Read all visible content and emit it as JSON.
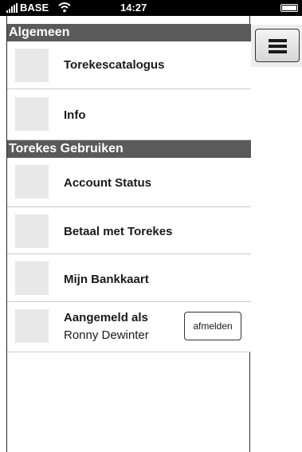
{
  "status_bar": {
    "carrier": "BASE",
    "time": "14:27",
    "icons": [
      "signal-icon",
      "wifi-icon",
      "battery-icon"
    ]
  },
  "sections": [
    {
      "header": "Algemeen",
      "items": [
        {
          "label": "Torekescatalogus"
        },
        {
          "label": "Info"
        }
      ]
    },
    {
      "header": "Torekes Gebruiken",
      "items": [
        {
          "label": "Account Status"
        },
        {
          "label": "Betaal met Torekes"
        },
        {
          "label": "Mijn Bankkaart"
        }
      ]
    }
  ],
  "account": {
    "label": "Aangemeld als",
    "user_name": "Ronny Dewinter",
    "logout_label": "afmelden"
  },
  "menu_button": {
    "icon": "hamburger-icon"
  }
}
